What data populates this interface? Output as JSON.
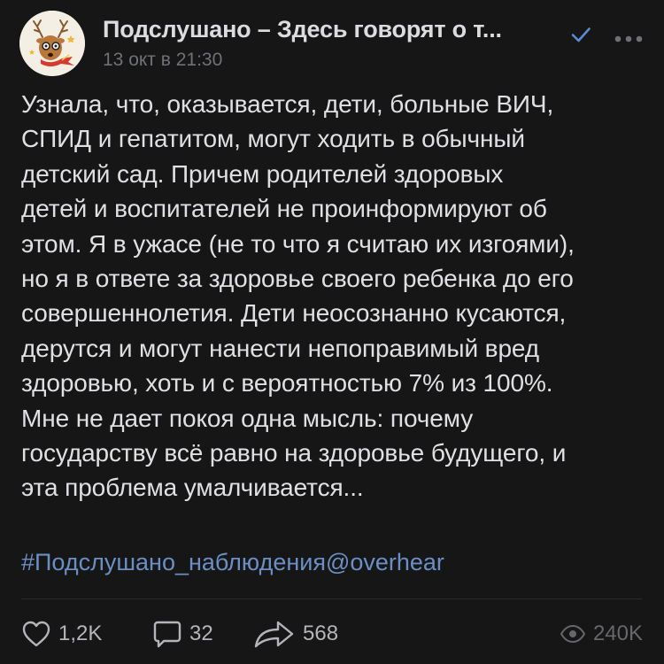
{
  "channel": {
    "name": "Подслушано – Здесь говорят о т...",
    "date": "13 окт в 21:30"
  },
  "post": {
    "lines": [
      "Узнала, что, оказывается, дети, больные ВИЧ,",
      "СПИД и гепатитом, могут ходить в обычный",
      "детский сад. Причем родителей здоровых",
      "детей и воспитателей не проинформируют об",
      "этом. Я в ужасе (не то что я считаю их изгоями),",
      "но я в ответе за здоровье своего ребенка до его",
      "совершеннолетия. Дети неосознанно кусаются,",
      "дерутся и могут нанести непоправимый вред",
      "здоровью, хоть и с вероятностью 7% из 100%.",
      "Мне не дает покоя одна мысль: почему",
      "государству всё равно на здоровье будущего, и",
      "эта проблема умалчивается..."
    ],
    "hashtag": "#Подслушано_наблюдения@overhear"
  },
  "footer": {
    "likes": "1,2K",
    "comments": "32",
    "shares": "568",
    "views": "240K"
  },
  "icons": {
    "verified": "check-icon",
    "more": "more-dots-icon",
    "like": "heart-icon",
    "comment": "comment-icon",
    "share": "share-arrow-icon",
    "views": "eye-icon"
  },
  "colors": {
    "background": "#161616",
    "text": "#e0e0e4",
    "muted": "#6f7178",
    "link": "#6b8fc4",
    "verified": "#5a8cd6"
  }
}
